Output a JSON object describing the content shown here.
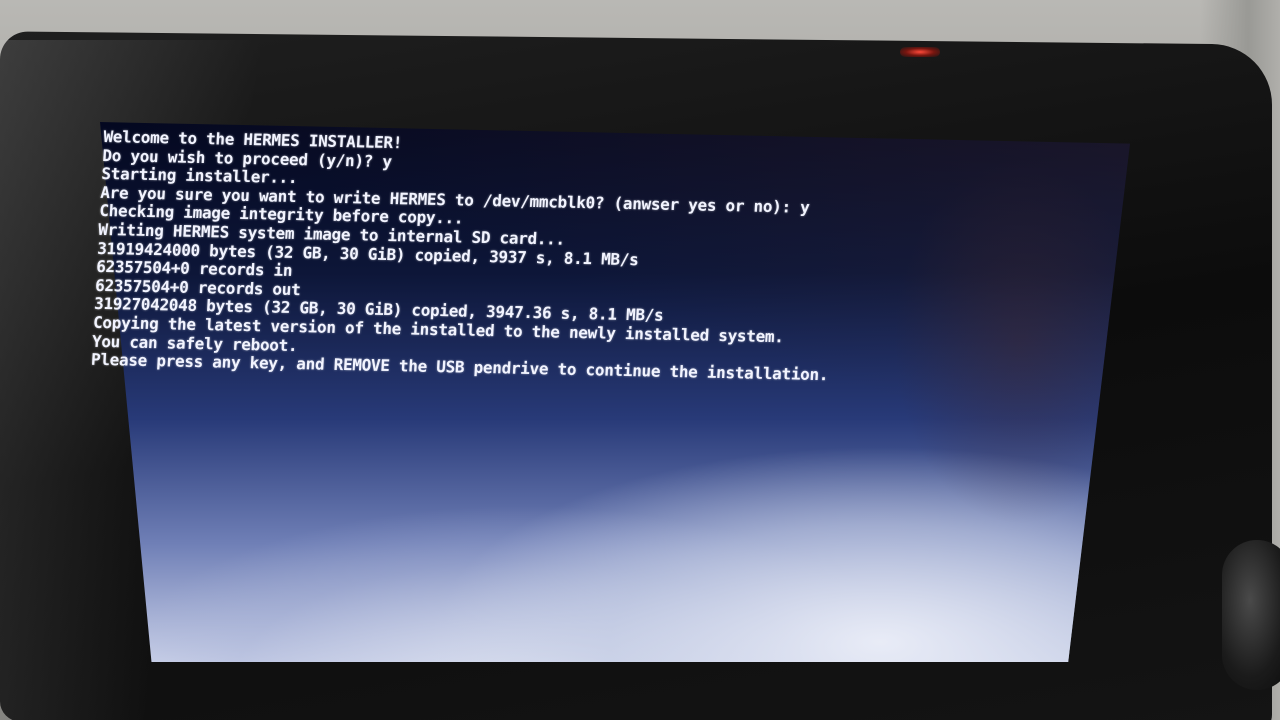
{
  "terminal": {
    "lines": [
      "Welcome to the HERMES INSTALLER!",
      "Do you wish to proceed (y/n)? y",
      "Starting installer...",
      "Are you sure you want to write HERMES to /dev/mmcblk0? (anwser yes or no): y",
      "Checking image integrity before copy...",
      "Writing HERMES system image to internal SD card...",
      "31919424000 bytes (32 GB, 30 GiB) copied, 3937 s, 8.1 MB/s",
      "62357504+0 records in",
      "62357504+0 records out",
      "31927042048 bytes (32 GB, 30 GiB) copied, 3947.36 s, 8.1 MB/s",
      "Copying the latest version of the installed to the newly installed system.",
      "You can safely reboot.",
      "Please press any key, and REMOVE the USB pendrive to continue the installation."
    ]
  },
  "colors": {
    "terminal_text": "#f2f4ff",
    "screen_background": "#0d1638",
    "bezel": "#111111",
    "led": "#ff4a3a"
  }
}
